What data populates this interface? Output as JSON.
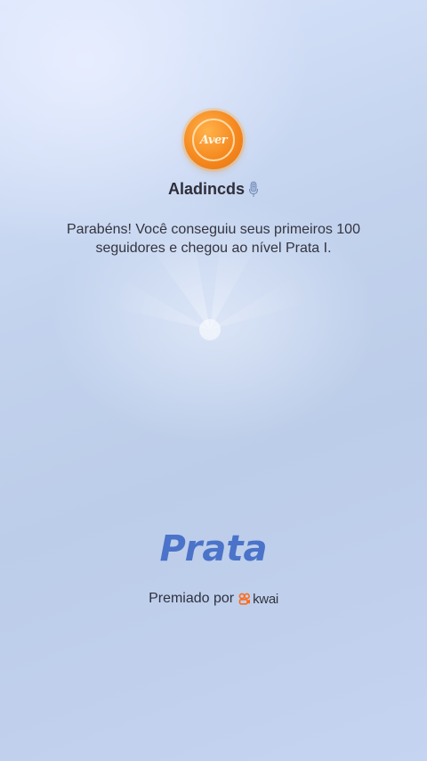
{
  "profile": {
    "avatar_text": "Aver",
    "username": "Aladincds",
    "username_icon": "microphone-icon"
  },
  "achievement": {
    "message": "Parabéns! Você conseguiu seus primeiros 100 seguidores e chegou ao nível Prata I.",
    "level_name": "Prata"
  },
  "footer": {
    "awarded_by_label": "Premiado por",
    "brand_name": "kwai",
    "brand_icon": "kwai-logo-icon"
  },
  "colors": {
    "level_text": "#4a73c9",
    "avatar_orange": "#f5891f",
    "brand_orange": "#ff6a1a"
  }
}
